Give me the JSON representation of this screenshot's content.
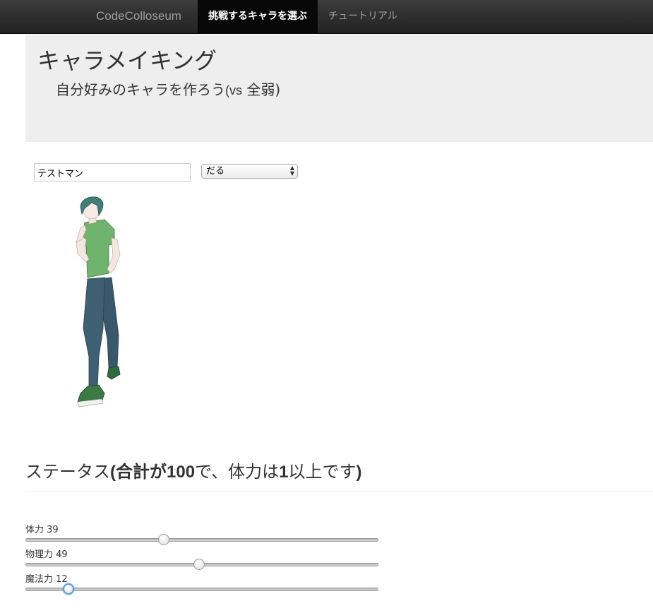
{
  "nav": {
    "brand": "CodeColloseum",
    "items": [
      {
        "label": "挑戦するキャラを選ぶ",
        "active": true
      },
      {
        "label": "チュートリアル",
        "active": false
      }
    ]
  },
  "jumbotron": {
    "title": "キャラメイキング",
    "subtitle_main": "自分好みのキャラを作ろう",
    "subtitle_vs": "(vs",
    "subtitle_end": " 全弱)"
  },
  "form": {
    "name_value": "テストマン",
    "type_selected": "だる"
  },
  "status": {
    "heading_1": "ステータス",
    "heading_2": "(合計が",
    "heading_3": "100",
    "heading_4": "で、体力は",
    "heading_5": "1",
    "heading_6": "以上です",
    "heading_7": ")",
    "stats": [
      {
        "label": "体力 39",
        "value": 39
      },
      {
        "label": "物理力 49",
        "value": 49
      },
      {
        "label": "魔法力 12",
        "value": 12
      }
    ]
  },
  "colors": {
    "navbar": "#222222",
    "jumbotron": "#eeeeee",
    "focus": "#5b9dd9",
    "shirt": "#6fb36f",
    "jeans": "#3f5f73",
    "hair": "#3f7f78"
  },
  "icons": [
    "select-arrows-icon"
  ]
}
